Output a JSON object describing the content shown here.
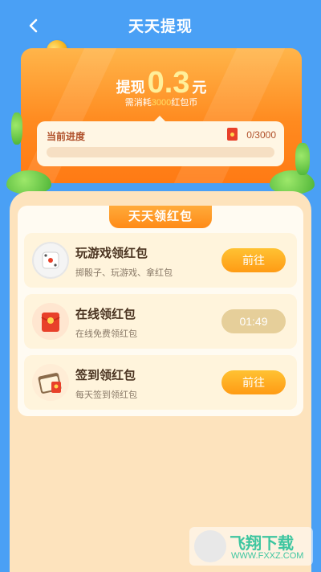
{
  "header": {
    "title": "天天提现"
  },
  "withdraw": {
    "label": "提现",
    "amount": "0.3",
    "unit": "元",
    "need_prefix": "需消耗",
    "need_amount": "3000",
    "need_suffix": "红包币"
  },
  "progress": {
    "label": "当前进度",
    "count": "0/3000",
    "fraction": 0.0
  },
  "panel": {
    "title": "天天领红包"
  },
  "tasks": [
    {
      "title": "玩游戏领红包",
      "subtitle": "掷骰子、玩游戏、拿红包",
      "button": "前往"
    },
    {
      "title": "在线领红包",
      "subtitle": "在线免费领红包",
      "button": "01:49"
    },
    {
      "title": "签到领红包",
      "subtitle": "每天签到领红包",
      "button": "前往"
    }
  ],
  "watermark": {
    "name": "飞翔下载",
    "url": "WWW.FXXZ.COM"
  },
  "colors": {
    "background": "#4aa0f5",
    "accent": "#ff8a17",
    "card": "#fde3bd"
  }
}
